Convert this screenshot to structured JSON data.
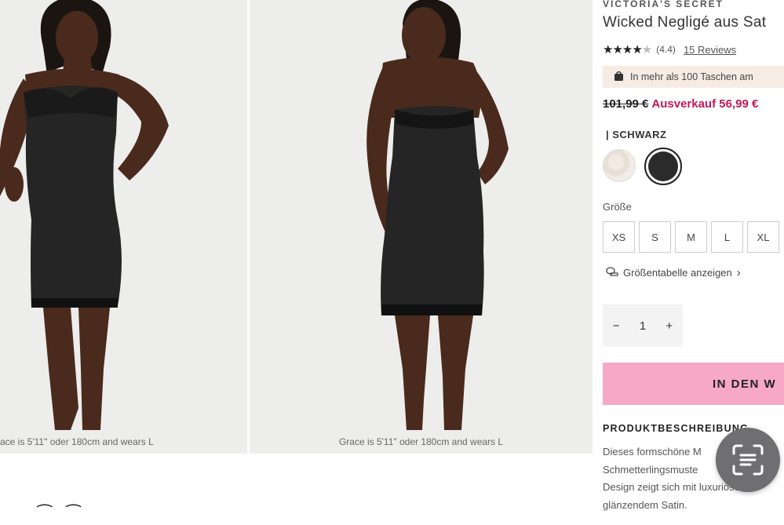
{
  "gallery": {
    "images": [
      {
        "alt": "Model front view in black satin slip dress",
        "caption": "ace is 5'11\" oder 180cm and wears L"
      },
      {
        "alt": "Model back view in black satin slip dress",
        "caption": "Grace is 5'11\" oder 180cm and wears L"
      }
    ]
  },
  "product": {
    "brand": "VICTORIA'S SECRET",
    "title": "Wicked Negligé aus Sat",
    "rating": {
      "stars": "★★★★",
      "half_star": "★",
      "value": "(4.4)",
      "reviews": "15 Reviews"
    },
    "bag_notice": "In mehr als 100 Taschen am",
    "price": {
      "original": "101,99 €",
      "sale": "Ausverkauf 56,99 €"
    },
    "color_label": "| SCHWARZ",
    "size_label": "Größe",
    "sizes": [
      "XS",
      "S",
      "M",
      "L",
      "XL"
    ],
    "size_chart": "Größentabelle anzeigen",
    "quantity": {
      "minus": "−",
      "value": "1",
      "plus": "+"
    },
    "add_button": "IN DEN W",
    "description_heading": "PRODUKTBESCHREIBUNG",
    "description_lines": [
      "Dieses formschöne M",
      "Schmetterlingsmuste",
      "Design zeigt sich mit luxuriöser S",
      "glänzendem Satin."
    ]
  },
  "icons": {
    "bag": "shopping-bag-icon",
    "size_chart": "measuring-tape-icon",
    "chevron": "chevron-right-icon",
    "lens": "text-scan-icon"
  },
  "colors": {
    "sale": "#c2185b",
    "add_button": "#f6a8c4",
    "bag_bar": "#f6ece4"
  }
}
